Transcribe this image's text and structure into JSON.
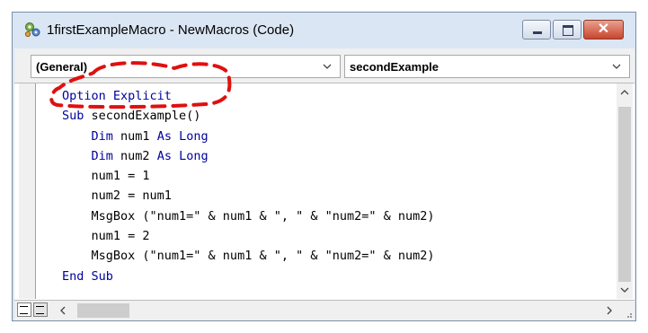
{
  "window": {
    "title": "1firstExampleMacro - NewMacros (Code)",
    "close_label": "✕"
  },
  "dropdowns": {
    "object": "(General)",
    "procedure": "secondExample"
  },
  "code": {
    "lines": [
      [
        {
          "t": "Option Explicit",
          "kw": true
        }
      ],
      [
        {
          "t": "Sub ",
          "kw": true
        },
        {
          "t": "secondExample()",
          "kw": false
        }
      ],
      [
        {
          "t": "    ",
          "kw": false
        },
        {
          "t": "Dim",
          "kw": true
        },
        {
          "t": " num1 ",
          "kw": false
        },
        {
          "t": "As Long",
          "kw": true
        }
      ],
      [
        {
          "t": "    ",
          "kw": false
        },
        {
          "t": "Dim",
          "kw": true
        },
        {
          "t": " num2 ",
          "kw": false
        },
        {
          "t": "As Long",
          "kw": true
        }
      ],
      [
        {
          "t": "    num1 = 1",
          "kw": false
        }
      ],
      [
        {
          "t": "    num2 = num1",
          "kw": false
        }
      ],
      [
        {
          "t": "    MsgBox (\"num1=\" & num1 & \", \" & \"num2=\" & num2)",
          "kw": false
        }
      ],
      [
        {
          "t": "    num1 = 2",
          "kw": false
        }
      ],
      [
        {
          "t": "    MsgBox (\"num1=\" & num1 & \", \" & \"num2=\" & num2)",
          "kw": false
        }
      ],
      [
        {
          "t": "End Sub",
          "kw": true
        }
      ]
    ]
  },
  "colors": {
    "keyword": "#0000a0",
    "annotation": "#e01010"
  }
}
